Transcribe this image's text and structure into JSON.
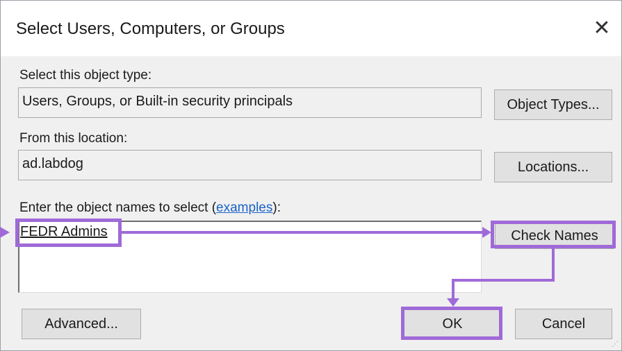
{
  "dialog": {
    "title": "Select Users, Computers, or Groups",
    "close_glyph": "✕"
  },
  "object_type": {
    "label": "Select this object type:",
    "value": "Users, Groups, or Built-in security principals",
    "button_label": "Object Types..."
  },
  "location": {
    "label": "From this location:",
    "value": "ad.labdog",
    "button_label": "Locations..."
  },
  "names": {
    "label_prefix": "Enter the object names to select (",
    "examples_link": "examples",
    "label_suffix": "):",
    "value": "FEDR Admins",
    "check_names_label": "Check Names"
  },
  "footer": {
    "advanced_label": "Advanced...",
    "ok_label": "OK",
    "cancel_label": "Cancel"
  },
  "colors": {
    "annotation": "#9f6ad8",
    "link": "#1a63c7",
    "dialog_bg": "#f0f0f0"
  }
}
